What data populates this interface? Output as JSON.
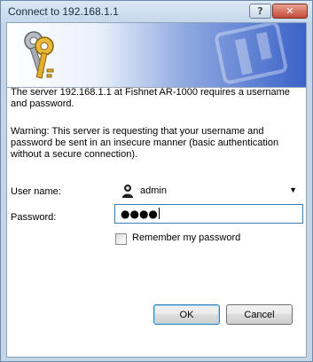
{
  "window": {
    "title": "Connect to 192.168.1.1",
    "help_label": "?",
    "close_label": "✕"
  },
  "dialog": {
    "message": "The server 192.168.1.1 at Fishnet AR-1000 requires a username and password.",
    "warning": "Warning: This server is requesting that your username and password be sent in an insecure manner (basic authentication without a secure connection).",
    "username_label": "User name:",
    "username_value": "admin",
    "password_label": "Password:",
    "password_value": "●●●●",
    "remember_label": "Remember my password",
    "remember_checked": false,
    "ok_label": "OK",
    "cancel_label": "Cancel"
  },
  "colors": {
    "banner_accent": "#3b62c9",
    "focus_border": "#3d7bad",
    "close_button": "#c4493a"
  },
  "icons": [
    "keys-icon",
    "background-key-icon",
    "user-icon",
    "help-icon",
    "close-icon",
    "chevron-down-icon"
  ]
}
